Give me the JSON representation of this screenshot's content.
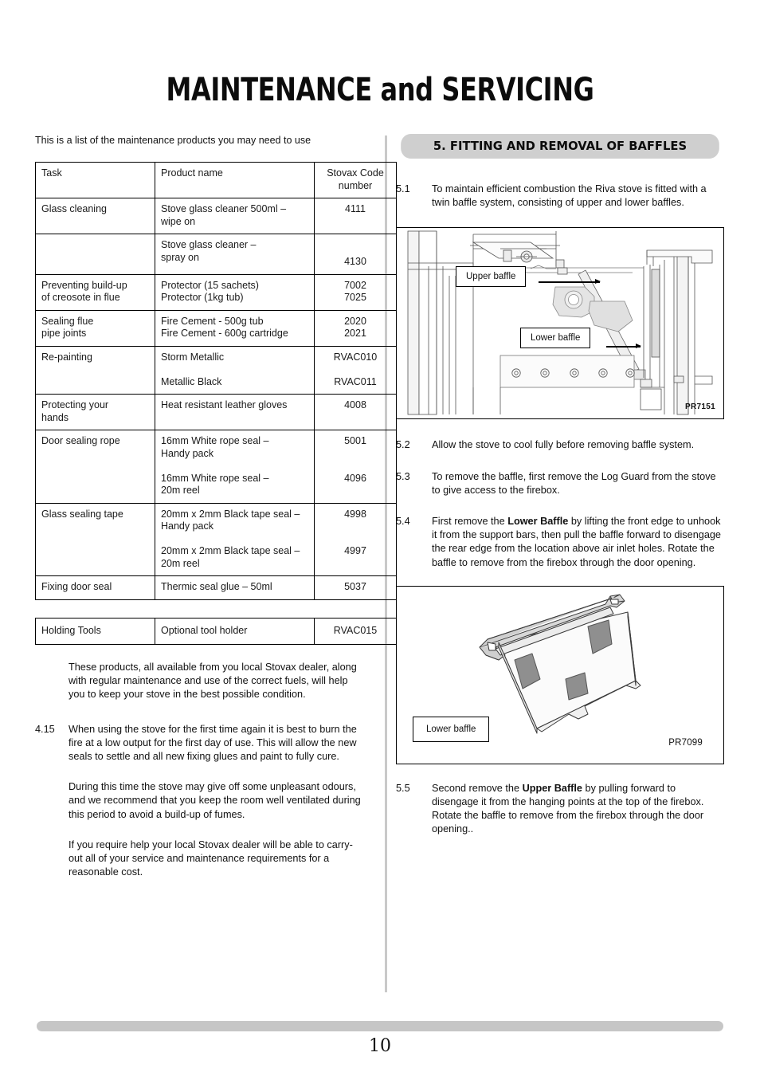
{
  "document": {
    "title": "MAINTENANCE and SERVICING",
    "page_number": "10"
  },
  "left_column": {
    "intro": "This is a list of the maintenance products you may need to use",
    "products_table": {
      "headers": [
        "Task",
        "Product name",
        "Stovax Code number"
      ],
      "rows": [
        {
          "task": "Glass cleaning",
          "product": "Stove glass cleaner 500ml –\nwipe on",
          "code": "4111"
        },
        {
          "task": "",
          "product": "Stove glass cleaner –\nspray on",
          "code": "4130"
        },
        {
          "task": "Preventing build-up\nof creosote in flue",
          "product": "Protector (15 sachets)\nProtector (1kg tub)",
          "code": "7002\n7025"
        },
        {
          "task": "Sealing flue\npipe joints",
          "product": "Fire Cement - 500g tub\nFire Cement - 600g cartridge",
          "code": "2020\n2021"
        },
        {
          "task": "Re-painting",
          "product": "Storm Metallic\n\nMetallic Black",
          "code": "RVAC010\n\nRVAC011"
        },
        {
          "task": "Protecting your\nhands",
          "product": "Heat resistant leather gloves",
          "code": "4008"
        },
        {
          "task": "Door sealing rope",
          "product": "16mm White rope seal –\nHandy pack\n\n16mm White rope seal –\n20m reel",
          "code": "5001\n\n\n4096"
        },
        {
          "task": "Glass sealing tape",
          "product": "20mm x 2mm Black tape seal –\nHandy pack\n\n20mm x 2mm Black tape seal –\n20m reel",
          "code": "4998\n\n\n4997"
        },
        {
          "task": "Fixing door seal",
          "product": "Thermic seal glue – 50ml",
          "code": "5037"
        }
      ]
    },
    "tools_table": {
      "rows": [
        {
          "task": "Holding Tools",
          "product": "Optional tool holder",
          "code": "RVAC015"
        }
      ]
    },
    "note_paragraph": "These products, all available from you local Stovax dealer, along with regular maintenance and use of the correct fuels, will help you to keep your stove in the best possible condition.",
    "item_4_15": {
      "number": "4.15",
      "paragraph_1": "When using the stove for the first time again it is best to burn the fire at a low output for the first day of use. This will allow the new seals to settle and all new fixing glues and paint to fully cure.",
      "paragraph_2": "During this time the stove may give off some unpleasant odours, and we recommend that you keep the room well ventilated during this period to avoid a build-up of fumes.",
      "paragraph_3": "If you require help your local Stovax dealer will be able to carry-out all of your service and maintenance requirements for a reasonable cost."
    }
  },
  "right_column": {
    "section_heading": "5. FITTING AND REMOVAL OF BAFFLES",
    "items": [
      {
        "number": "5.1",
        "text": "To maintain efficient combustion the Riva stove is fitted with a twin baffle system, consisting of upper and lower baffles."
      },
      {
        "number": "5.2",
        "text": "Allow the stove to cool fully before removing baffle system."
      },
      {
        "number": "5.3",
        "text": "To remove the baffle, first remove the Log Guard from the stove to give access to the firebox."
      },
      {
        "number": "5.4",
        "prefix": "First remove the ",
        "bold": "Lower Baffle",
        "suffix": " by lifting the front edge to unhook it from the support bars, then pull the baffle forward to disengage the rear edge from the location above air inlet holes. Rotate the baffle to remove from the firebox through the door opening."
      },
      {
        "number": "5.5",
        "prefix": "Second remove the ",
        "bold": "Upper Baffle",
        "suffix": " by pulling forward to disengage it from the hanging points at the top of the firebox. Rotate the baffle to remove from the firebox through the door opening.."
      }
    ],
    "figure_1": {
      "callout_upper": "Upper baffle",
      "callout_lower": "Lower baffle",
      "part_code": "PR7151"
    },
    "figure_2": {
      "callout": "Lower baffle",
      "part_code": "PR7099"
    }
  },
  "colors": {
    "banner_gray": "#cfcfcf",
    "footer_bar_gray": "#c6c6c6",
    "divider_gray": "#c9c9c9",
    "text_black": "#111111"
  }
}
